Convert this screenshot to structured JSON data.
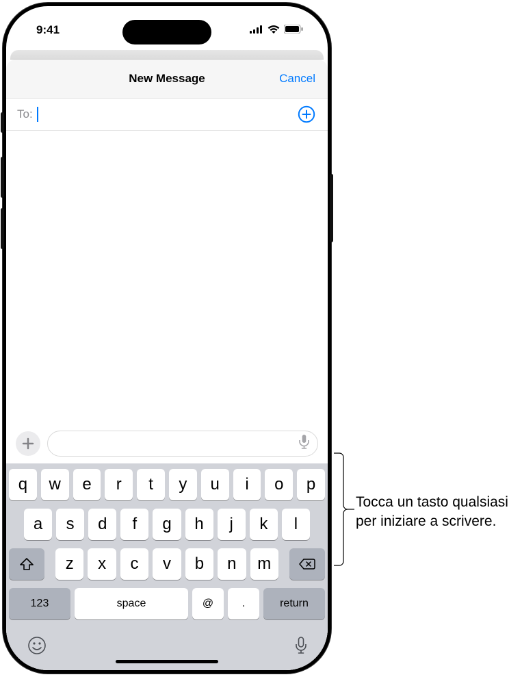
{
  "status": {
    "time": "9:41"
  },
  "nav": {
    "title": "New Message",
    "cancel": "Cancel"
  },
  "to_field": {
    "label": "To:"
  },
  "keyboard": {
    "row1": [
      "q",
      "w",
      "e",
      "r",
      "t",
      "y",
      "u",
      "i",
      "o",
      "p"
    ],
    "row2": [
      "a",
      "s",
      "d",
      "f",
      "g",
      "h",
      "j",
      "k",
      "l"
    ],
    "row3": [
      "z",
      "x",
      "c",
      "v",
      "b",
      "n",
      "m"
    ],
    "num_key": "123",
    "space": "space",
    "at": "@",
    "dot": ".",
    "return": "return"
  },
  "callout": {
    "text": "Tocca un tasto qualsiasi per iniziare a scrivere."
  }
}
